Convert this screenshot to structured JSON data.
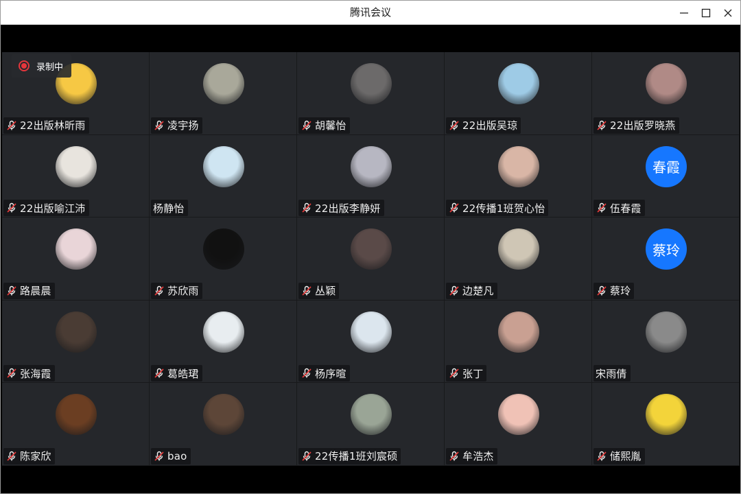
{
  "window": {
    "title": "腾讯会议"
  },
  "recording": {
    "label": "录制中",
    "color": "#e6363c"
  },
  "colors": {
    "tile_bg": "#25272b",
    "mic_muted": "#e23b3b",
    "avatar_text_bg": "#1677ff"
  },
  "participants": [
    {
      "name": "22出版林昕雨",
      "muted": true,
      "avatar": {
        "type": "image",
        "icon": "emoji-face-avatar",
        "color": "#f6c844"
      }
    },
    {
      "name": "凌宇扬",
      "muted": true,
      "avatar": {
        "type": "image",
        "icon": "portrait-photo",
        "color": "#a9a89a"
      }
    },
    {
      "name": "胡馨怡",
      "muted": true,
      "avatar": {
        "type": "image",
        "icon": "portrait-photo",
        "color": "#6c6a6a"
      }
    },
    {
      "name": "22出版吴琼",
      "muted": true,
      "avatar": {
        "type": "image",
        "icon": "landscape-photo",
        "color": "#9ecbe6"
      }
    },
    {
      "name": "22出版罗晓燕",
      "muted": true,
      "avatar": {
        "type": "image",
        "icon": "portrait-photo",
        "color": "#b08a86"
      }
    },
    {
      "name": "22出版喻江沛",
      "muted": true,
      "avatar": {
        "type": "image",
        "icon": "dog-avatar",
        "color": "#e8e4de"
      }
    },
    {
      "name": "杨静怡",
      "muted": false,
      "avatar": {
        "type": "image",
        "icon": "anime-girl-avatar",
        "color": "#cfe5f2"
      }
    },
    {
      "name": "22出版李静妍",
      "muted": true,
      "avatar": {
        "type": "image",
        "icon": "ultraman-avatar",
        "color": "#b7b7c2"
      }
    },
    {
      "name": "22传播1班贺心怡",
      "muted": true,
      "avatar": {
        "type": "image",
        "icon": "plush-toy-avatar",
        "color": "#d9b6a6"
      }
    },
    {
      "name": "伍春霞",
      "muted": true,
      "avatar": {
        "type": "text",
        "text": "春霞",
        "color": "#1677ff"
      }
    },
    {
      "name": "路晨晨",
      "muted": true,
      "avatar": {
        "type": "image",
        "icon": "cartoon-avatar",
        "color": "#e9d5d8"
      }
    },
    {
      "name": "苏欣雨",
      "muted": true,
      "avatar": {
        "type": "image",
        "icon": "red-can-avatar",
        "color": "#111111"
      }
    },
    {
      "name": "丛颖",
      "muted": true,
      "avatar": {
        "type": "image",
        "icon": "cat-photo",
        "color": "#5a4a48"
      }
    },
    {
      "name": "边楚凡",
      "muted": true,
      "avatar": {
        "type": "image",
        "icon": "bear-photo",
        "color": "#cfc6b5"
      }
    },
    {
      "name": "蔡玲",
      "muted": true,
      "avatar": {
        "type": "text",
        "text": "蔡玲",
        "color": "#1677ff"
      }
    },
    {
      "name": "张海霞",
      "muted": true,
      "avatar": {
        "type": "image",
        "icon": "meme-photo",
        "color": "#4a3c34"
      }
    },
    {
      "name": "葛皓珺",
      "muted": true,
      "avatar": {
        "type": "image",
        "icon": "bunny-girl-avatar",
        "color": "#e8edf0"
      }
    },
    {
      "name": "杨序暄",
      "muted": true,
      "avatar": {
        "type": "image",
        "icon": "beach-photo",
        "color": "#dce6ee"
      }
    },
    {
      "name": "张丁",
      "muted": true,
      "avatar": {
        "type": "image",
        "icon": "portrait-photo",
        "color": "#c9a092"
      }
    },
    {
      "name": "宋雨倩",
      "muted": false,
      "avatar": {
        "type": "image",
        "icon": "bw-portrait-photo",
        "color": "#8a8a8a"
      }
    },
    {
      "name": "陈家欣",
      "muted": true,
      "avatar": {
        "type": "image",
        "icon": "portrait-photo",
        "color": "#6b3e22"
      }
    },
    {
      "name": "bao",
      "muted": true,
      "avatar": {
        "type": "image",
        "icon": "meme-photo",
        "color": "#5d4638"
      }
    },
    {
      "name": "22传播1班刘宸硕",
      "muted": true,
      "avatar": {
        "type": "image",
        "icon": "tree-photo",
        "color": "#9aa596"
      }
    },
    {
      "name": "牟浩杰",
      "muted": true,
      "avatar": {
        "type": "image",
        "icon": "crayon-shin-chan-avatar",
        "color": "#f0c2b6"
      }
    },
    {
      "name": "储熙胤",
      "muted": true,
      "avatar": {
        "type": "image",
        "icon": "pikachu-avatar",
        "color": "#f3d43a"
      }
    }
  ]
}
